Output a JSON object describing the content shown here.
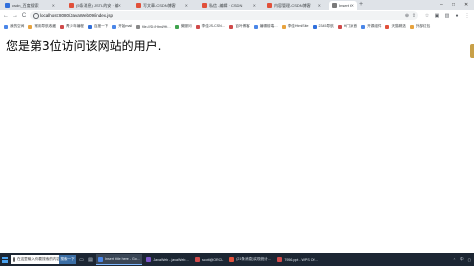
{
  "tabs": [
    {
      "label": "csdn_百度搜索",
      "color": "#2f6fdc",
      "active": false
    },
    {
      "label": "(5条消息) JSTL的安 · 编辑 · CSDN",
      "color": "#e1503a",
      "active": false
    },
    {
      "label": "写文章-CSDN博客",
      "color": "#e1503a",
      "active": false
    },
    {
      "label": "私信 -编辑 · CSDN",
      "color": "#e1503a",
      "active": false
    },
    {
      "label": "内容管理-CSDN博客",
      "color": "#e1503a",
      "active": false
    },
    {
      "label": "Insert title here",
      "color": "#7a7a7a",
      "active": true
    }
  ],
  "new_tab_label": "+",
  "window_controls": {
    "minimize": "–",
    "maximize": "□",
    "close": "✕"
  },
  "toolbar": {
    "back": "←",
    "forward": "→",
    "reload": "C",
    "url": "localhost:8080/JavaWeb09/index.jsp"
  },
  "bookmarks": [
    {
      "label": "我的空间",
      "color": "#4a86e8"
    },
    {
      "label": "常用导航收藏",
      "color": "#e8a33d"
    },
    {
      "label": "青少年编程",
      "color": "#d04a4a"
    },
    {
      "label": "百度一下",
      "color": "#2f6fdc"
    },
    {
      "label": "开始mail",
      "color": "#4a86e8"
    },
    {
      "label": "file:///D:/Html/Ht…",
      "color": "#888888"
    },
    {
      "label": "微服问",
      "color": "#3fa34d"
    },
    {
      "label": "李佳JS-CSN…",
      "color": "#d04a4a"
    },
    {
      "label": "百叶博客",
      "color": "#d04a4a"
    },
    {
      "label": "编辑前端…",
      "color": "#4a86e8"
    },
    {
      "label": "李佳HtmlSite",
      "color": "#e8a33d"
    },
    {
      "label": "2345导航",
      "color": "#2f6fdc"
    },
    {
      "label": "H门派首",
      "color": "#d04a4a"
    },
    {
      "label": "开源组件",
      "color": "#4a86e8"
    },
    {
      "label": "天猫精选",
      "color": "#e1503a"
    },
    {
      "label": "外部红包",
      "color": "#e8a33d"
    }
  ],
  "page": {
    "message": "您是第3位访问该网站的用户."
  },
  "taskbar": {
    "search_placeholder": "在这里输入你要搜索的内容",
    "search_button": "搜索一下",
    "apps": [
      {
        "label": "Insert title here - Go…",
        "color": "#4a86e8",
        "active": true
      },
      {
        "label": "JavaWeb - javaWeb…",
        "color": "#7b56c9",
        "active": false
      },
      {
        "label": "scott@ORCL",
        "color": "#d04a4a",
        "active": false
      },
      {
        "label": "(21条消息)实现统计…",
        "color": "#e1503a",
        "active": false
      },
      {
        "label": "7956.ppt - WPS Of…",
        "color": "#d04a4a",
        "active": false
      }
    ],
    "tray_text": "中"
  }
}
